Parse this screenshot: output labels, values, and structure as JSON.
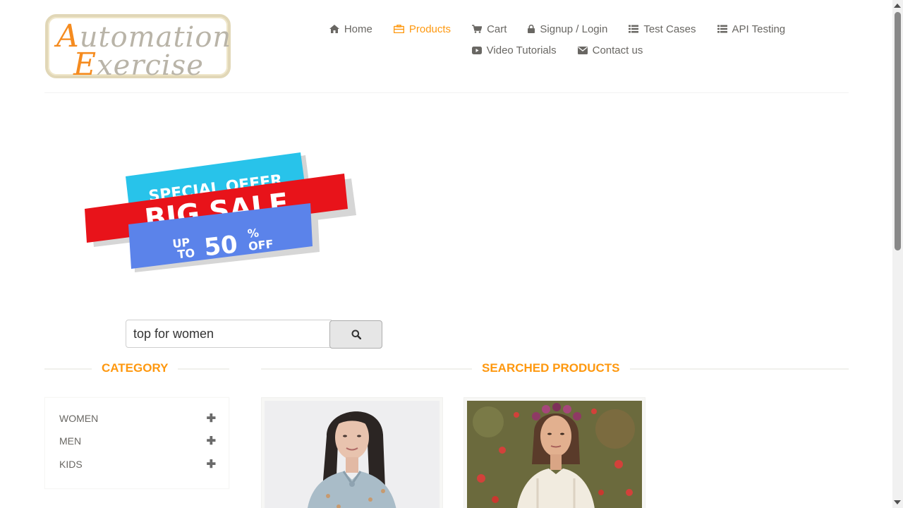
{
  "logo": {
    "line1_cap": "A",
    "line1_rest": "utomation",
    "line2_cap": "E",
    "line2_rest": "xercise"
  },
  "nav": {
    "row1": [
      {
        "label": "Home",
        "icon": "home-icon",
        "active": false
      },
      {
        "label": "Products",
        "icon": "briefcase-icon",
        "active": true
      },
      {
        "label": "Cart",
        "icon": "cart-icon",
        "active": false
      },
      {
        "label": "Signup / Login",
        "icon": "lock-icon",
        "active": false
      },
      {
        "label": "Test Cases",
        "icon": "list-icon",
        "active": false
      },
      {
        "label": "API Testing",
        "icon": "list-icon",
        "active": false
      }
    ],
    "row2": [
      {
        "label": "Video Tutorials",
        "icon": "youtube-icon",
        "active": false
      },
      {
        "label": "Contact us",
        "icon": "envelope-icon",
        "active": false
      }
    ]
  },
  "banner": {
    "line1": "SPECIAL OFFER",
    "line2": "BIG SALE",
    "up": "UP",
    "to": "TO",
    "pct": "50",
    "pct_sign": "%",
    "off": "OFF"
  },
  "search": {
    "value": "top for women",
    "button_icon": "search-icon"
  },
  "category": {
    "title": "Category",
    "items": [
      {
        "label": "Women"
      },
      {
        "label": "Men"
      },
      {
        "label": "Kids"
      }
    ]
  },
  "products": {
    "title": "Searched Products"
  },
  "colors": {
    "accent": "#FE980F",
    "text": "#696763",
    "logo_orange": "#F58B1F"
  }
}
